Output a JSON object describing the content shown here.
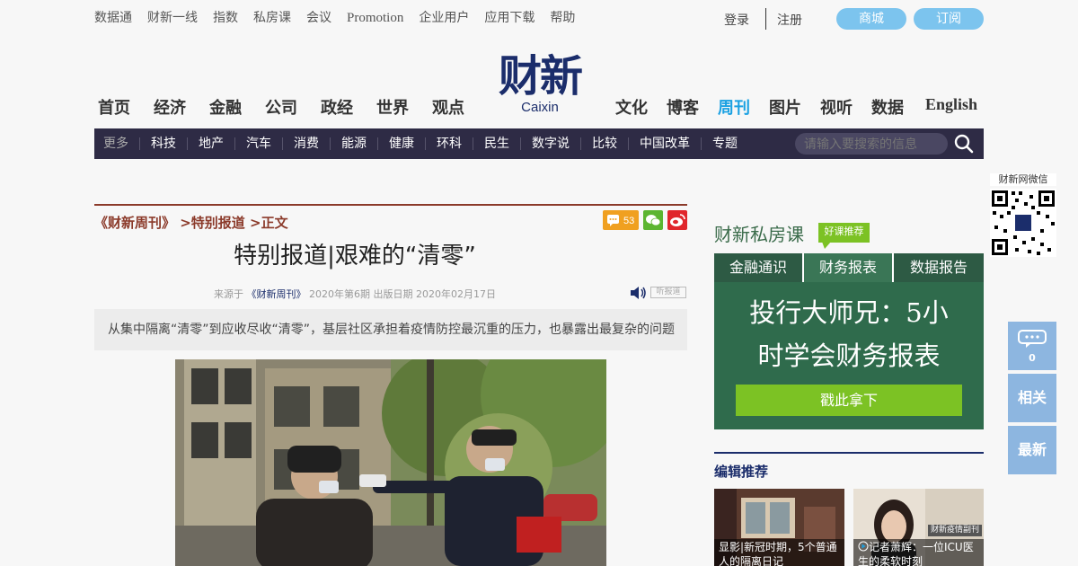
{
  "top_links": [
    "数据通",
    "财新一线",
    "指数",
    "私房课",
    "会议",
    "Promotion",
    "企业用户",
    "应用下载",
    "帮助"
  ],
  "login": "登录",
  "register": "注册",
  "shop": "商城",
  "subscribe": "订阅",
  "logo": {
    "cn": "财新",
    "en": "Caixin"
  },
  "main_nav_left": [
    "首页",
    "经济",
    "金融",
    "公司",
    "政经",
    "世界",
    "观点"
  ],
  "main_nav_right": [
    "文化",
    "博客",
    "周刊",
    "图片",
    "视听",
    "数据",
    "English"
  ],
  "main_nav_active": "周刊",
  "sub_nav": [
    "更多",
    "科技",
    "地产",
    "汽车",
    "消费",
    "能源",
    "健康",
    "环科",
    "民生",
    "数字说",
    "比较",
    "中国改革",
    "专题"
  ],
  "search": {
    "placeholder": "请输入要搜索的信息"
  },
  "article": {
    "breadcrumb": "《财新周刊》 >特别报道 >正文",
    "comment_count": "53",
    "title": "特别报道|艰难的“清零”",
    "meta_prefix": "来源于",
    "meta_source": "《财新周刊》",
    "meta_suffix": "2020年第6期 出版日期 2020年02月17日",
    "listen": "听报道",
    "summary": "从集中隔离“清零”到应收尽收“清零”，基层社区承担着疫情防控最沉重的压力，也暴露出最复杂的问题"
  },
  "right": {
    "private_class": "财新私房课",
    "badge": "好课推荐",
    "tabs": [
      "金融通识",
      "财务报表",
      "数据报告"
    ],
    "active_tab": "财务报表",
    "board_line1": "投行大师兄：5小",
    "board_line2": "时学会财务报表",
    "board_button": "戳此拿下",
    "editor_pick": "编辑推荐",
    "thumb1": "显影|新冠时期，5个普通人的隔离日记",
    "thumb2": "记者萧辉：一位ICU医生的柔软时刻",
    "thumb2_tag": "财新疫情副刊"
  },
  "floaters": {
    "qr_label": "财新网微信",
    "comment_count": "0",
    "related": "相关",
    "latest": "最新"
  },
  "colors": {
    "nav_bg": "#2e2b45",
    "brand_navy": "#1b2d6b",
    "accent_blue": "#1ba1e2",
    "board_green": "#2f6b4c",
    "cta_green": "#7cc224"
  }
}
